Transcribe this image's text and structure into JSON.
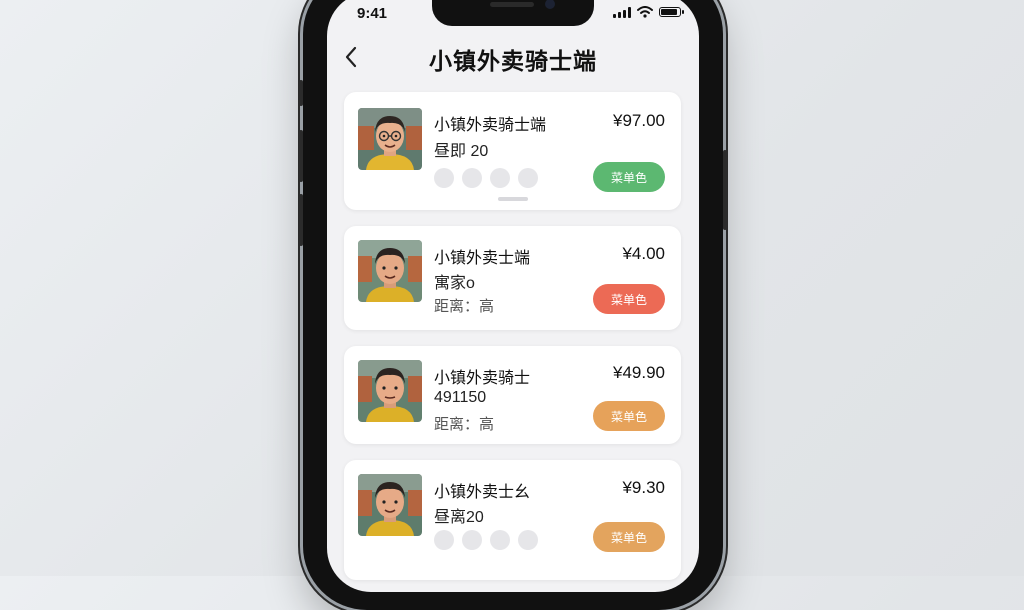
{
  "status_bar": {
    "time": "9:41"
  },
  "nav": {
    "title": "小镇外卖骑士端"
  },
  "colors": {
    "green": "#5cb871",
    "red": "#ec6a55",
    "orange": "#e6a25a",
    "orange2": "#e3a45e"
  },
  "orders": [
    {
      "name": "小镇外卖骑士端",
      "line1": "昼即 20",
      "line2": "",
      "price": "¥97.00",
      "button": "菜单色"
    },
    {
      "name": "小镇外卖士端",
      "line1": "寓家o",
      "line2": "距离：高",
      "price": "¥4.00",
      "button": "菜单色"
    },
    {
      "name": "小镇外卖骑士",
      "line1": "491150",
      "line2": "距离：高",
      "price": "¥49.90",
      "button": "菜单色"
    },
    {
      "name": "小镇外卖士幺",
      "line1": "昼离20",
      "line2": "",
      "price": "¥9.30",
      "button": "菜单色"
    }
  ]
}
